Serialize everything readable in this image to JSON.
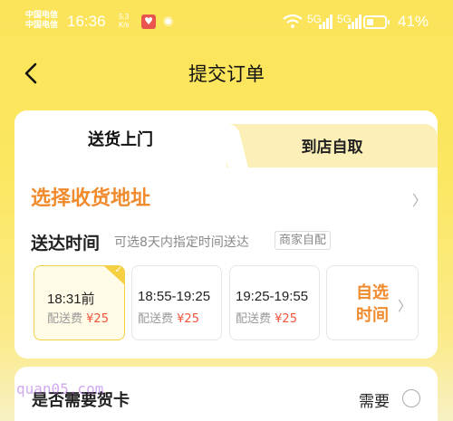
{
  "status_bar": {
    "carrier_1": "中国电信",
    "carrier_2": "中国电信",
    "time": "16:36",
    "speed_value": "5.3",
    "speed_unit": "K/s",
    "signal_1": "5G",
    "signal_2": "5G",
    "battery_percent": "41%",
    "battery_level": 0.41,
    "icons": [
      "wifi-icon",
      "signal-icon",
      "battery-icon"
    ]
  },
  "header": {
    "title": "提交订单",
    "back_icon": "chevron-left-icon"
  },
  "tabs": [
    {
      "label": "送货上门",
      "active": true
    },
    {
      "label": "到店自取",
      "active": false
    }
  ],
  "address": {
    "label": "选择收货地址"
  },
  "delivery_time": {
    "title": "送达时间",
    "hint": "可选8天内指定时间送达",
    "badge": "商家自配",
    "slots": [
      {
        "time": "18:31前",
        "fee_label": "配送费",
        "fee": "¥25",
        "selected": true
      },
      {
        "time": "18:55-19:25",
        "fee_label": "配送费",
        "fee": "¥25",
        "selected": false
      },
      {
        "time": "19:25-19:55",
        "fee_label": "配送费",
        "fee": "¥25",
        "selected": false
      }
    ],
    "custom_line1": "自选",
    "custom_line2": "时间"
  },
  "greeting_card": {
    "label": "是否需要贺卡",
    "option": "需要"
  },
  "watermark": "quan05.com",
  "colors": {
    "accent_orange": "#f08a2c",
    "price_red": "#f0543b",
    "brand_yellow": "#f6d043",
    "background_yellow": "#fbe45a"
  }
}
